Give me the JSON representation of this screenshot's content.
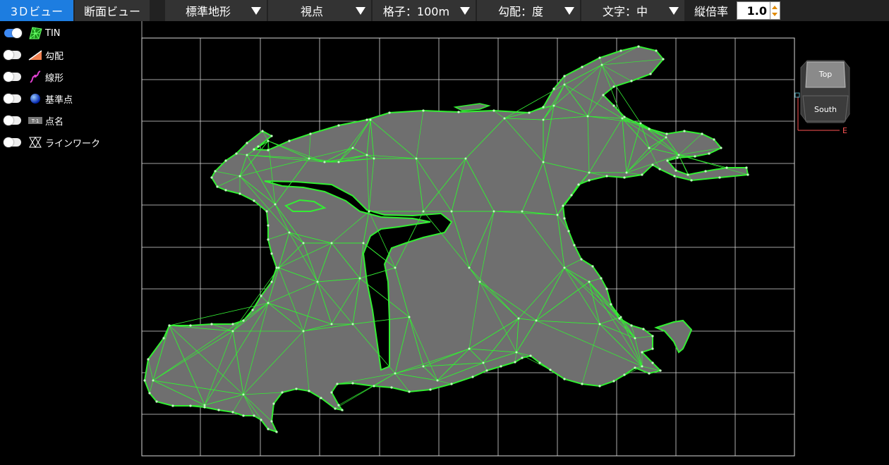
{
  "toolbar": {
    "tabs": [
      {
        "label": "3Ｄビュー",
        "active": true
      },
      {
        "label": "断面ビュー",
        "active": false
      }
    ],
    "dropdowns": [
      {
        "label": "標準地形"
      },
      {
        "label": "視点"
      },
      {
        "label": "格子：100m"
      },
      {
        "label": "勾配：度"
      },
      {
        "label": "文字：中"
      }
    ],
    "vertical_scale_label": "縦倍率",
    "vertical_scale_value": "1.0"
  },
  "layers": [
    {
      "label": "TIN",
      "on": true,
      "icon": "tin-icon"
    },
    {
      "label": "勾配",
      "on": false,
      "icon": "slope-icon"
    },
    {
      "label": "線形",
      "on": false,
      "icon": "alignment-icon"
    },
    {
      "label": "基準点",
      "on": false,
      "icon": "benchmark-sphere-icon"
    },
    {
      "label": "点名",
      "on": false,
      "icon": "point-name-icon",
      "icon_text": "T-1"
    },
    {
      "label": "ラインワーク",
      "on": false,
      "icon": "linework-icon"
    }
  ],
  "navcube": {
    "top_label": "Top",
    "front_label": "South",
    "axis_label": "E"
  },
  "colors": {
    "tin_edge": "#33ee33",
    "surface": "#6f6f6f",
    "grid": "#d8d8d8",
    "axis": "#ff5555"
  }
}
